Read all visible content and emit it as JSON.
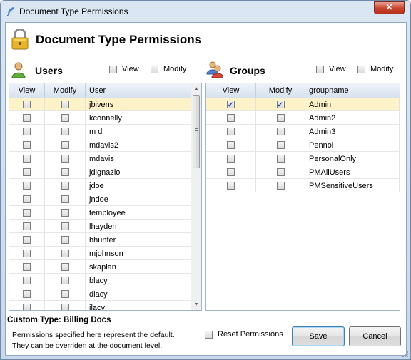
{
  "window": {
    "title": "Document Type Permissions",
    "close_label": "✕"
  },
  "header": {
    "title": "Document Type Permissions",
    "icon": "lock-icon"
  },
  "users": {
    "section_title": "Users",
    "icon": "user-icon",
    "view_all_label": "View",
    "modify_all_label": "Modify",
    "columns": {
      "view": "View",
      "modify": "Modify",
      "name": "User"
    },
    "rows": [
      {
        "name": "jbivens",
        "view": false,
        "modify": false,
        "selected": true
      },
      {
        "name": "kconnelly",
        "view": false,
        "modify": false
      },
      {
        "name": "m d",
        "view": false,
        "modify": false
      },
      {
        "name": "mdavis2",
        "view": false,
        "modify": false
      },
      {
        "name": "mdavis",
        "view": false,
        "modify": false
      },
      {
        "name": "jdignazio",
        "view": false,
        "modify": false
      },
      {
        "name": "jdoe",
        "view": false,
        "modify": false
      },
      {
        "name": "jndoe",
        "view": false,
        "modify": false
      },
      {
        "name": "temployee",
        "view": false,
        "modify": false
      },
      {
        "name": "lhayden",
        "view": false,
        "modify": false
      },
      {
        "name": "bhunter",
        "view": false,
        "modify": false
      },
      {
        "name": "mjohnson",
        "view": false,
        "modify": false
      },
      {
        "name": "skaplan",
        "view": false,
        "modify": false
      },
      {
        "name": "blacy",
        "view": false,
        "modify": false
      },
      {
        "name": "dlacy",
        "view": false,
        "modify": false
      },
      {
        "name": "jlacy",
        "view": false,
        "modify": false
      }
    ]
  },
  "groups": {
    "section_title": "Groups",
    "icon": "group-icon",
    "view_all_label": "View",
    "modify_all_label": "Modify",
    "columns": {
      "view": "View",
      "modify": "Modify",
      "name": "groupname"
    },
    "rows": [
      {
        "name": "Admin",
        "view": true,
        "modify": true,
        "selected": true
      },
      {
        "name": "Admin2",
        "view": false,
        "modify": false
      },
      {
        "name": "Admin3",
        "view": false,
        "modify": false
      },
      {
        "name": "Pennoi",
        "view": false,
        "modify": false
      },
      {
        "name": "PersonalOnly",
        "view": false,
        "modify": false
      },
      {
        "name": "PMAllUsers",
        "view": false,
        "modify": false
      },
      {
        "name": "PMSensitiveUsers",
        "view": false,
        "modify": false
      }
    ]
  },
  "footer": {
    "custom_type": "Custom Type: Billing Docs",
    "note_line1": "Permissions specified here represent the default.",
    "note_line2": "They can be overriden  at the document level.",
    "reset_label": "Reset Permissions",
    "save_label": "Save",
    "cancel_label": "Cancel"
  }
}
